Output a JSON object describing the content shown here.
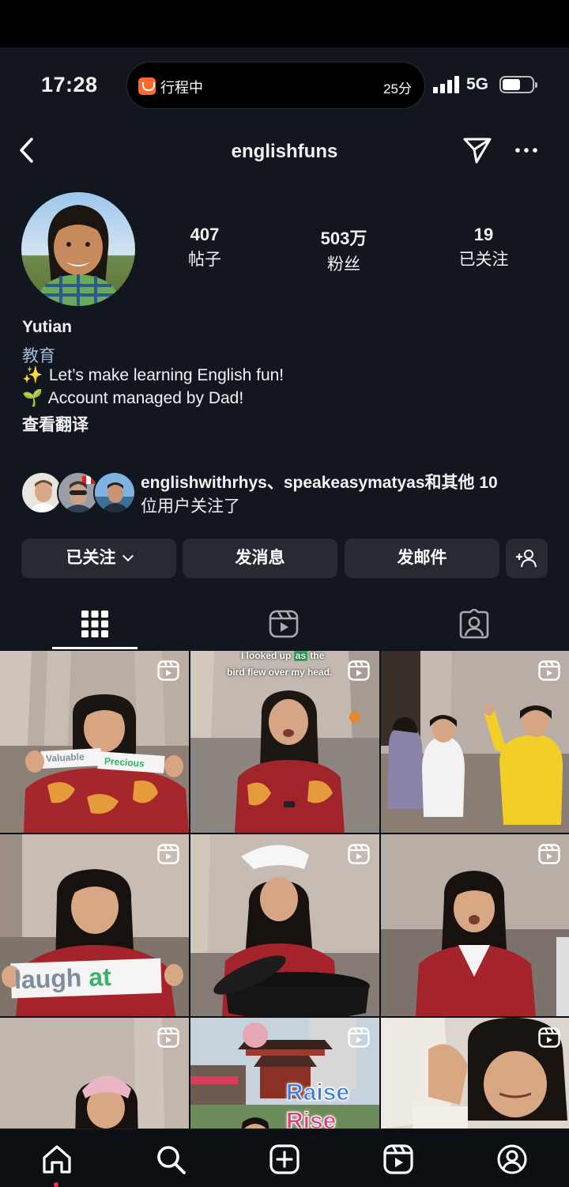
{
  "status": {
    "time": "17:28",
    "island_text": "行程中",
    "island_right": "25分",
    "network": "5G"
  },
  "header": {
    "username": "englishfuns"
  },
  "profile": {
    "stats": [
      {
        "value": "407",
        "label": "帖子"
      },
      {
        "value": "503万",
        "label": "粉丝"
      },
      {
        "value": "19",
        "label": "已关注"
      }
    ],
    "display_name": "Yutian",
    "category": "教育",
    "bio": [
      {
        "emoji": "✨",
        "text": "Let’s make learning English fun!"
      },
      {
        "emoji": "🌱",
        "text": "Account managed by Dad!"
      }
    ],
    "translate_label": "查看翻译",
    "followed_by": {
      "line1": "englishwithrhys、speakeasymatyas和其他 10",
      "line2": "位用户关注了"
    }
  },
  "actions": {
    "following": "已关注",
    "message": "发消息",
    "email": "发邮件"
  },
  "grid": {
    "captions": {
      "c1_a": "Valuable",
      "c1_b": "Precious",
      "c2_a": "I looked up",
      "c2_as": "as",
      "c2_b": "the",
      "c2_c": "bird flew over my head.",
      "c4_a": "laugh",
      "c4_b": "at",
      "c8_a": "Raise",
      "c8_b": "Rise"
    }
  },
  "colors": {
    "background": "#0c0f14",
    "panel": "#12161e",
    "button": "#262b33",
    "category": "#a0b8d8",
    "notification_dot": "#ff3040"
  }
}
